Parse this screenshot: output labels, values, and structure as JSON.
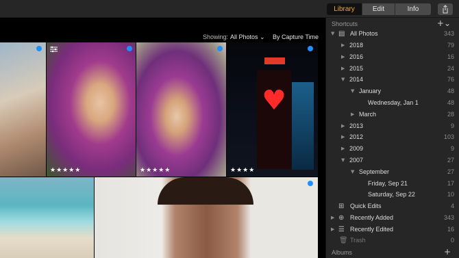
{
  "tabs": [
    {
      "label": "Library"
    },
    {
      "label": "Edit"
    },
    {
      "label": "Info"
    }
  ],
  "filter": {
    "showing_label": "Showing:",
    "showing_value": "All Photos ⌄",
    "sort_value": "By Capture Time ⌄"
  },
  "photos": [
    {
      "stars": ""
    },
    {
      "stars": "★★★★★"
    },
    {
      "stars": "★★★★★"
    },
    {
      "stars": "★★★★"
    },
    {
      "stars": ""
    },
    {
      "stars": ""
    }
  ],
  "sidebar": {
    "shortcuts_header": "Shortcuts",
    "albums_header": "Albums",
    "plus_label": "+",
    "plus_label_dd": "+⌄",
    "rows": [
      {
        "label": "All Photos",
        "count": "343"
      },
      {
        "label": "2018",
        "count": "79"
      },
      {
        "label": "2016",
        "count": "16"
      },
      {
        "label": "2015",
        "count": "24"
      },
      {
        "label": "2014",
        "count": "76"
      },
      {
        "label": "January",
        "count": "48"
      },
      {
        "label": "Wednesday, Jan 1",
        "count": "48"
      },
      {
        "label": "March",
        "count": "28"
      },
      {
        "label": "2013",
        "count": "9"
      },
      {
        "label": "2012",
        "count": "103"
      },
      {
        "label": "2009",
        "count": "9"
      },
      {
        "label": "2007",
        "count": "27"
      },
      {
        "label": "September",
        "count": "27"
      },
      {
        "label": "Friday, Sep 21",
        "count": "17"
      },
      {
        "label": "Saturday, Sep 22",
        "count": "10"
      },
      {
        "label": "Quick Edits",
        "count": "4"
      },
      {
        "label": "Recently Added",
        "count": "343"
      },
      {
        "label": "Recently Edited",
        "count": "16"
      },
      {
        "label": "Trash",
        "count": "0"
      }
    ]
  }
}
